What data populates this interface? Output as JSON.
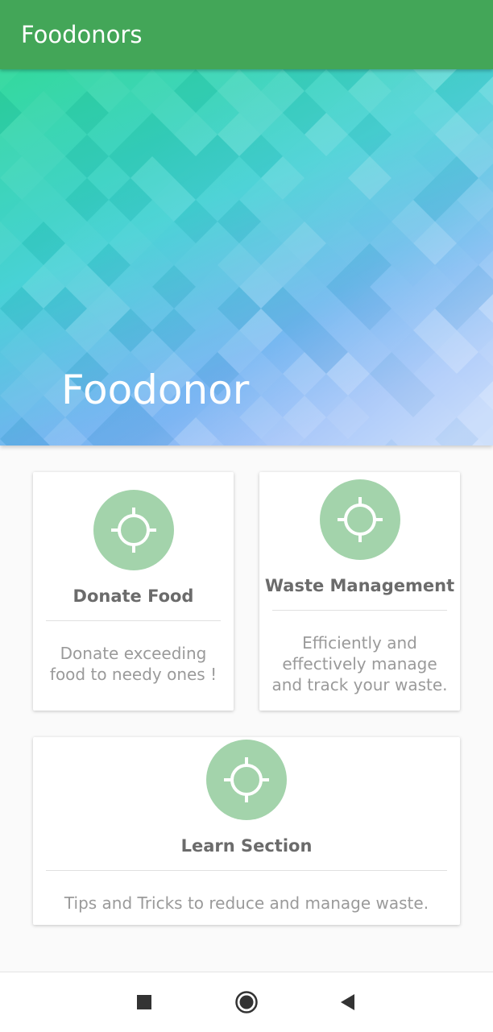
{
  "app_bar": {
    "title": "Foodonors"
  },
  "hero": {
    "title": "Foodonor"
  },
  "cards": [
    {
      "title": "Donate Food",
      "description": "Donate exceeding food to needy ones !",
      "icon": "gps-target-icon"
    },
    {
      "title": "Waste Management",
      "description": "Efficiently and effectively manage and track your waste.",
      "icon": "gps-target-icon"
    },
    {
      "title": "Learn Section",
      "description": "Tips and Tricks to reduce and manage waste.",
      "icon": "gps-target-icon"
    }
  ],
  "nav": {
    "buttons": [
      "recents-icon",
      "home-icon",
      "back-icon"
    ]
  },
  "colors": {
    "app_bar": "#43a658",
    "icon_circle": "#a3d3ab",
    "card_title": "#6b6b6b",
    "card_desc": "#9a9a9a"
  }
}
